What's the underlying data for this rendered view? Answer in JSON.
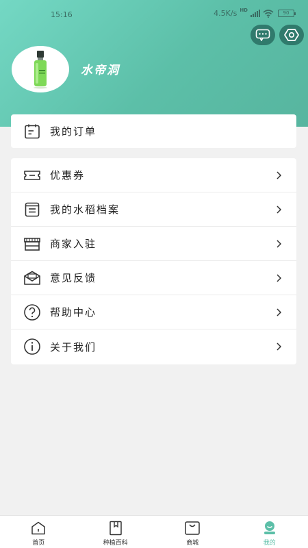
{
  "status_bar": {
    "time": "15:16",
    "speed": "4.5K/s",
    "network": "HD",
    "battery": "90"
  },
  "profile": {
    "username": "水帝洞",
    "avatar_icon": "product-bottle-icon"
  },
  "header_actions": {
    "message_icon": "message-icon",
    "settings_icon": "settings-icon"
  },
  "orders": {
    "label": "我的订单",
    "icon": "order-list-icon"
  },
  "menu": {
    "items": [
      {
        "label": "优惠券",
        "icon": "coupon-icon"
      },
      {
        "label": "我的水稻档案",
        "icon": "archive-icon"
      },
      {
        "label": "商家入驻",
        "icon": "store-icon"
      },
      {
        "label": "意见反馈",
        "icon": "feedback-icon"
      },
      {
        "label": "帮助中心",
        "icon": "help-icon"
      },
      {
        "label": "关于我们",
        "icon": "info-icon"
      }
    ]
  },
  "tabbar": {
    "items": [
      {
        "label": "首页",
        "icon": "home-icon"
      },
      {
        "label": "种植百科",
        "icon": "book-icon"
      },
      {
        "label": "商城",
        "icon": "shopping-bag-icon"
      },
      {
        "label": "我的",
        "icon": "profile-icon"
      }
    ],
    "active": "我的"
  },
  "colors": {
    "brand": "#5cbfa8",
    "header_start": "#74d8c4",
    "header_end": "#57b59f"
  }
}
